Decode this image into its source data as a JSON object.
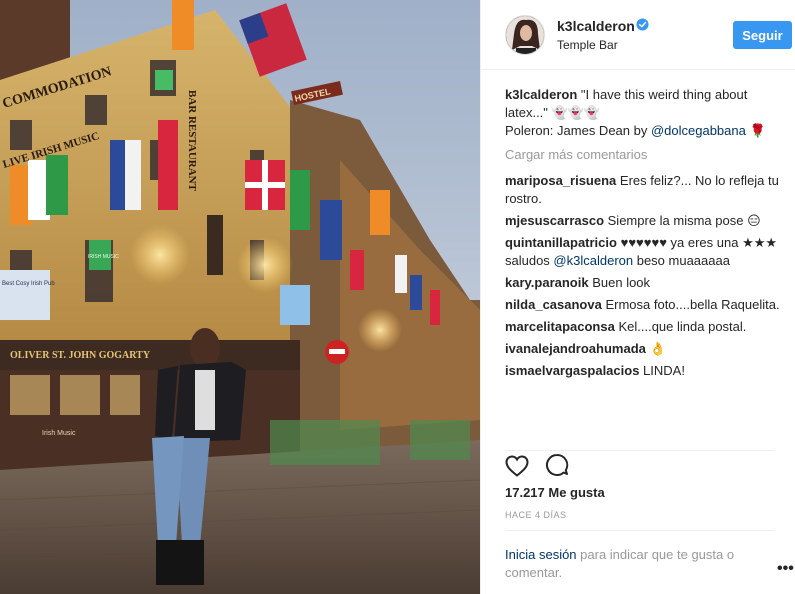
{
  "post": {
    "username": "k3lcalderon",
    "location": "Temple Bar",
    "follow_label": "Seguir",
    "caption_user": "k3lcalderon",
    "caption_text": "\"I have this weird thing about latex...\" 👻👻👻",
    "caption_line2_prefix": "Poleron: James Dean by ",
    "caption_mention": "@dolcegabbana",
    "caption_line2_suffix": " 🌹",
    "load_more": "Cargar más comentarios",
    "likes": "17.217 Me gusta",
    "time": "HACE 4 DÍAS",
    "login_link": "Inicia sesión",
    "login_text": " para indicar que te gusta o comentar.",
    "more_label": "•••"
  },
  "comments": [
    {
      "user": "mariposa_risuena",
      "text": "Eres feliz?... No lo refleja tu rostro."
    },
    {
      "user": "mjesuscarrasco",
      "text": "Siempre la misma pose 😑"
    },
    {
      "user": "quintanillapatricio",
      "text": "♥♥♥♥♥♥ ya eres una ★★★ saludos ",
      "mention": "@k3lcalderon",
      "after": " beso muaaaaaa"
    },
    {
      "user": "kary.paranoik",
      "text": "Buen look"
    },
    {
      "user": "nilda_casanova",
      "text": "Ermosa foto....bella Raquelita."
    },
    {
      "user": "marcelitapaconsa",
      "text": "Kel....que linda postal."
    },
    {
      "user": "ivanalejandroahumada",
      "text": "👌"
    },
    {
      "user": "ismaelvargaspalacios",
      "text": "LINDA!"
    }
  ],
  "photo_signs": {
    "top_sign": "COMMODATION",
    "irish_music": "LIVE IRISH MUSIC",
    "gogarty": "OLIVER ST. JOHN GOGARTY",
    "hostel": "HOSTEL",
    "restaurant": "BAR RESTAURANT",
    "small_sign": "IRISH MUSIC",
    "left_sign": "Best Cosy Irish Pub",
    "lower_sign": "Irish Music"
  },
  "colors": {
    "accent": "#3897f0",
    "mention": "#003569",
    "muted": "#999999"
  },
  "icons": [
    "verified-badge-icon",
    "heart-icon",
    "comment-bubble-icon",
    "more-options-icon"
  ]
}
